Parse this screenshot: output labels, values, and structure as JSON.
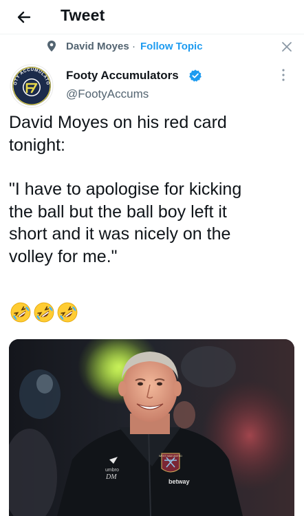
{
  "header": {
    "title": "Tweet"
  },
  "topic": {
    "name": "David Moyes",
    "separator": "·",
    "follow_label": "Follow Topic"
  },
  "tweet": {
    "author_name": "Footy Accumulators",
    "author_handle": "@FootyAccums",
    "avatar_text": "FOOTY ACCUMULATORS",
    "text_lines": [
      "David Moyes on his red card",
      "tonight:",
      "",
      "\"I have to apologise for kicking",
      "the ball but the ball boy left it",
      "short and it was nicely on the",
      "volley for me.\""
    ],
    "emoji": [
      "rolling-on-floor-laughing",
      "rolling-on-floor-laughing",
      "rolling-on-floor-laughing"
    ]
  },
  "media": {
    "jacket_initials": "DM",
    "sponsor": "betway",
    "crest_text": "WEST HAM UNITED"
  },
  "colors": {
    "accent": "#1d9bf0",
    "secondary_text": "#536471",
    "verified": "#1d9bf0"
  }
}
